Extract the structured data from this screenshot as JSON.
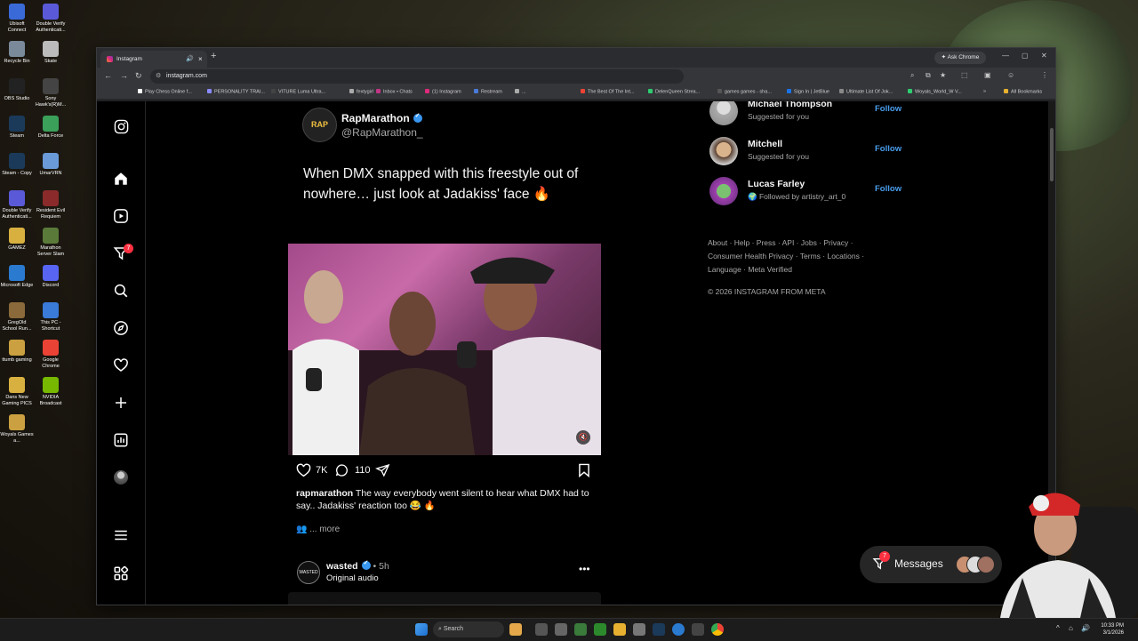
{
  "desktop": {
    "icons": [
      "Ubisoft Connect",
      "Double Verify Authenticati...",
      "Recycle Bin",
      "Skate",
      "OBS Studio",
      "Sony Hawk's(R)M...",
      "Steam",
      "Delta Force",
      "Steam - Copy",
      "UmarVRN",
      "Double Verify Authenticati...",
      "Resident Evil Requiem",
      "GAMEZ",
      "Marathon Server Slam",
      "Microsoft Edge",
      "Discord",
      "GregOld School Run...",
      "This PC - Shortcut",
      "ttumb gaming",
      "Google Chrome",
      "Dans New Gaming PICS",
      "NVIDIA Broadcast",
      "Woyals Games a..."
    ]
  },
  "browser": {
    "tab_title": "Instagram",
    "new_tab": "+",
    "ask_chrome": "Ask Chrome",
    "url": "instagram.com",
    "bookmarks": [
      "Play Chess Online f...",
      "PERSONALITY TRAI...",
      "VITURE Luma Ultra...",
      "fextygirl",
      "Inbox • Chats",
      "(1) Instagram",
      "Restream",
      "...",
      "The Best Of The Int...",
      "DelenQueen Strea...",
      "games games - sha...",
      "Sign In | JetBlue",
      "Ultimate List Of Jok...",
      "Woyals_World_W V...",
      "»",
      "All Bookmarks"
    ]
  },
  "nav": {
    "notifications_badge": "7"
  },
  "post": {
    "username": "RapMarathon",
    "handle": "@RapMarathon_",
    "avatar_text": "RAP",
    "text": "When DMX snapped with this freestyle out of nowhere… just look at Jadakiss' face 🔥",
    "likes": "7K",
    "comments": "110",
    "caption_user": "rapmarathon",
    "caption_text": "The way everybody went silent to hear what DMX had to say.. Jadakiss' reaction too 😂 🔥",
    "more": "... more"
  },
  "post2": {
    "username": "wasted",
    "time": "• 5h",
    "audio": "Original audio",
    "avatar_text": "WASTED",
    "dots": "•••"
  },
  "suggestions": [
    {
      "name": "Michael Thompson",
      "sub": "Suggested for you",
      "follow": "Follow"
    },
    {
      "name": "Mitchell",
      "sub": "Suggested for you",
      "follow": "Follow"
    },
    {
      "name": "Lucas Farley",
      "sub": "🌍 Followed by artistry_art_0",
      "follow": "Follow"
    }
  ],
  "footer": {
    "links": "About · Help · Press · API · Jobs · Privacy · Consumer Health Privacy · Terms · Locations · Language · Meta Verified",
    "copyright": "© 2026 INSTAGRAM FROM META"
  },
  "messages": {
    "label": "Messages",
    "badge": "7"
  },
  "taskbar": {
    "search": "Search",
    "time": "10:33 PM",
    "date": "3/1/2026"
  },
  "colors": {
    "instagram_blue": "#4a9eed",
    "badge_red": "#ff3040",
    "page_bg": "#000000"
  }
}
